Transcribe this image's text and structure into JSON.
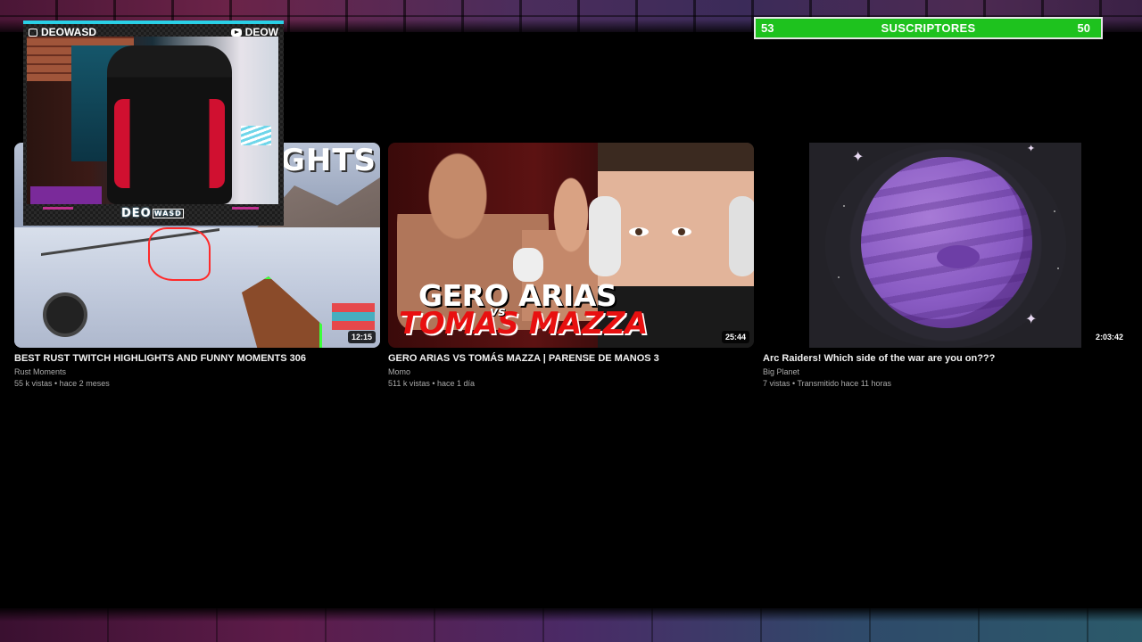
{
  "subscribers": {
    "current": "53",
    "label": "SUSCRIPTORES",
    "goal": "50",
    "bar_color": "#1ec21e"
  },
  "webcam": {
    "twitch_name": "DEOWASD",
    "youtube_name": "DEOW",
    "logo_text": "DEO",
    "logo_keys": "WASD"
  },
  "videos": [
    {
      "thumb_heading": "GHTS",
      "duration": "12:15",
      "title": "BEST RUST TWITCH HIGHLIGHTS AND FUNNY MOMENTS 306",
      "channel": "Rust Moments",
      "meta": "55 k vistas • hace 2 meses"
    },
    {
      "thumb_line1": "GERO ARIAS",
      "thumb_vs": "vs",
      "thumb_line2": "TOMAS MAZZA",
      "duration": "25:44",
      "title": "GERO ARIAS VS TOMÁS MAZZA | PARENSE DE MANOS 3",
      "channel": "Momo",
      "meta": "511 k vistas • hace 1 día"
    },
    {
      "duration": "2:03:42",
      "title": "Arc Raiders! Which side of the war are you on???",
      "channel": "Big Planet",
      "meta": "7 vistas • Transmitido hace 11 horas"
    }
  ]
}
